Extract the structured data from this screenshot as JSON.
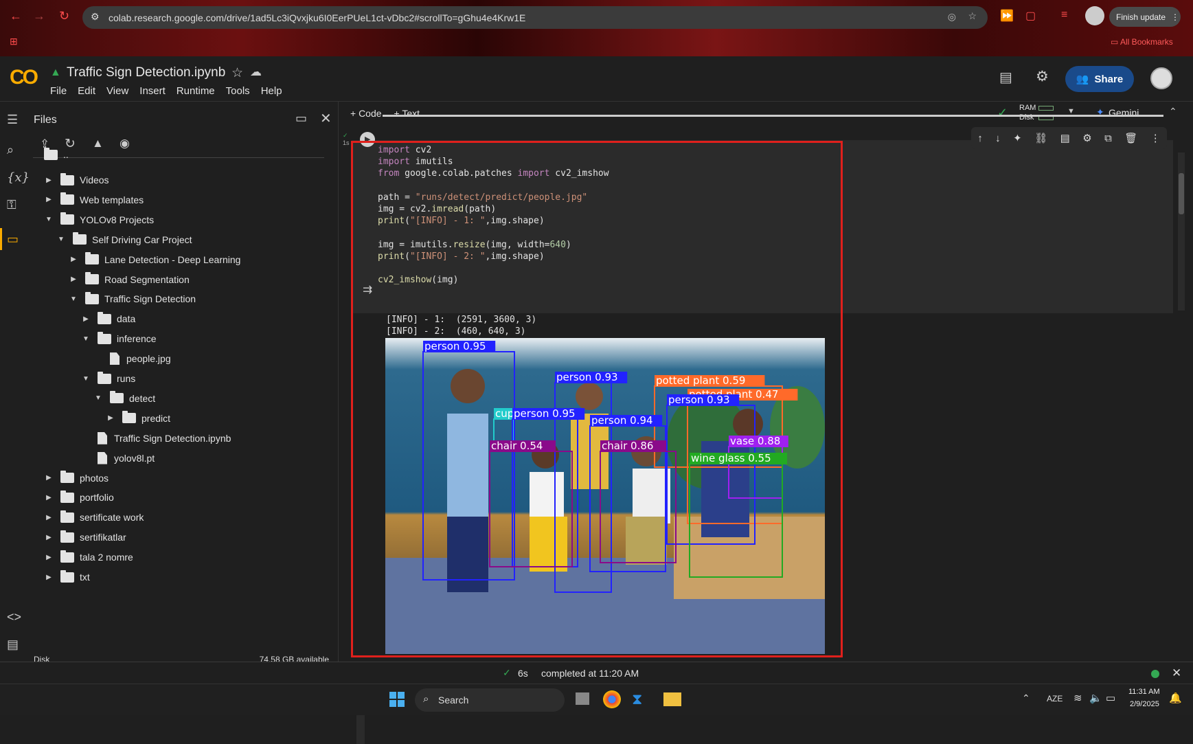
{
  "browser": {
    "url": "colab.research.google.com/drive/1ad5Lc3iQvxjku6I0EerPUeL1ct-vDbc2#scrollTo=gGhu4e4Krw1E",
    "finish_update": "Finish update",
    "all_bookmarks": "All Bookmarks"
  },
  "colab": {
    "logo": "CO",
    "notebook_title": "Traffic Sign Detection.ipynb",
    "menu": [
      "File",
      "Edit",
      "View",
      "Insert",
      "Runtime",
      "Tools",
      "Help"
    ],
    "share_label": "Share"
  },
  "files_panel": {
    "title": "Files",
    "parent": "..",
    "tree": [
      {
        "label": "Videos",
        "type": "folder",
        "depth": 1,
        "expanded": false
      },
      {
        "label": "Web templates",
        "type": "folder",
        "depth": 1,
        "expanded": false
      },
      {
        "label": "YOLOv8 Projects",
        "type": "folder",
        "depth": 1,
        "expanded": true
      },
      {
        "label": "Self Driving Car Project",
        "type": "folder",
        "depth": 2,
        "expanded": true
      },
      {
        "label": "Lane Detection - Deep Learning",
        "type": "folder",
        "depth": 3,
        "expanded": false
      },
      {
        "label": "Road Segmentation",
        "type": "folder",
        "depth": 3,
        "expanded": false
      },
      {
        "label": "Traffic Sign Detection",
        "type": "folder",
        "depth": 3,
        "expanded": true
      },
      {
        "label": "data",
        "type": "folder",
        "depth": 4,
        "expanded": false
      },
      {
        "label": "inference",
        "type": "folder",
        "depth": 4,
        "expanded": true
      },
      {
        "label": "people.jpg",
        "type": "file",
        "depth": 5
      },
      {
        "label": "runs",
        "type": "folder",
        "depth": 4,
        "expanded": true
      },
      {
        "label": "detect",
        "type": "folder",
        "depth": 5,
        "expanded": true
      },
      {
        "label": "predict",
        "type": "folder",
        "depth": 6,
        "expanded": false
      },
      {
        "label": "Traffic Sign Detection.ipynb",
        "type": "file",
        "depth": 4
      },
      {
        "label": "yolov8l.pt",
        "type": "file",
        "depth": 4
      },
      {
        "label": "photos",
        "type": "folder",
        "depth": 1,
        "expanded": false
      },
      {
        "label": "portfolio",
        "type": "folder",
        "depth": 1,
        "expanded": false
      },
      {
        "label": "sertificate work",
        "type": "folder",
        "depth": 1,
        "expanded": false
      },
      {
        "label": "sertifikatlar",
        "type": "folder",
        "depth": 1,
        "expanded": false
      },
      {
        "label": "tala 2 nomre",
        "type": "folder",
        "depth": 1,
        "expanded": false
      },
      {
        "label": "txt",
        "type": "folder",
        "depth": 1,
        "expanded": false
      }
    ],
    "disk_label": "Disk",
    "disk_available": "74.58 GB available"
  },
  "notebook": {
    "add_code": "+ Code",
    "add_text": "+ Text",
    "ram": "RAM",
    "disk": "Disk",
    "gemini": "Gemini",
    "exec_time": "1s",
    "output_lines": [
      "[INFO] - 1:  (2591, 3600, 3)",
      "[INFO] - 2:  (460, 640, 3)"
    ],
    "detections": [
      {
        "label": "person 0.95",
        "color": "#2222ff"
      },
      {
        "label": "person 0.93",
        "color": "#2222ff"
      },
      {
        "label": "potted plant 0.59",
        "color": "#ff6a2a"
      },
      {
        "label": "potted plant 0.47",
        "color": "#ff6a2a"
      },
      {
        "label": "person 0.93",
        "color": "#2222ff"
      },
      {
        "label": "cup",
        "color": "#22cccc"
      },
      {
        "label": "person 0.95",
        "color": "#2222ff"
      },
      {
        "label": "person 0.94",
        "color": "#2222ff"
      },
      {
        "label": "chair 0.54",
        "color": "#8a0a8a"
      },
      {
        "label": "chair 0.86",
        "color": "#8a0a8a"
      },
      {
        "label": "vase 0.88",
        "color": "#a020f0"
      },
      {
        "label": "wine glass 0.55",
        "color": "#22aa22"
      }
    ]
  },
  "status": {
    "time": "6s",
    "completed": "completed at 11:20 AM"
  },
  "taskbar": {
    "search": "Search",
    "lang": "AZE",
    "clock_time": "11:31 AM",
    "clock_date": "2/9/2025"
  }
}
